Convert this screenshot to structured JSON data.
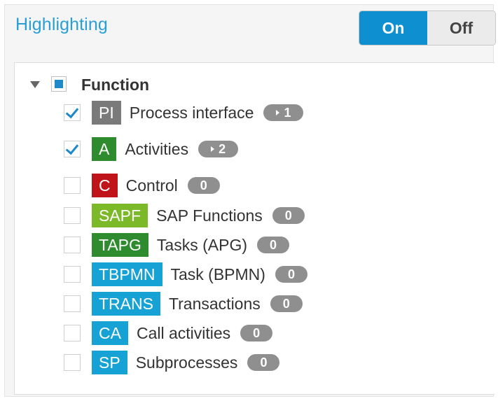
{
  "header": {
    "title": "Highlighting",
    "toggle_on": "On",
    "toggle_off": "Off"
  },
  "colors": {
    "title": "#2a9fd6",
    "toggle_active": "#0e8fd0",
    "check": "#1e88c8",
    "count_pill": "#8f8f8f"
  },
  "tree": {
    "group_label": "Function",
    "items": [
      {
        "badge": "PI",
        "badge_color": "#7a7a7a",
        "label": "Process interface",
        "count": "1",
        "has_arrow": true,
        "checked": true
      },
      {
        "badge": "A",
        "badge_color": "#2e8b2e",
        "label": "Activities",
        "count": "2",
        "has_arrow": true,
        "checked": true
      },
      {
        "badge": "C",
        "badge_color": "#c0141b",
        "label": "Control",
        "count": "0",
        "has_arrow": false,
        "checked": false
      },
      {
        "badge": "SAPF",
        "badge_color": "#7cb928",
        "label": "SAP Functions",
        "count": "0",
        "has_arrow": false,
        "checked": false
      },
      {
        "badge": "TAPG",
        "badge_color": "#2e8b2e",
        "label": "Tasks (APG)",
        "count": "0",
        "has_arrow": false,
        "checked": false
      },
      {
        "badge": "TBPMN",
        "badge_color": "#17a2d6",
        "label": "Task (BPMN)",
        "count": "0",
        "has_arrow": false,
        "checked": false
      },
      {
        "badge": "TRANS",
        "badge_color": "#17a2d6",
        "label": "Transactions",
        "count": "0",
        "has_arrow": false,
        "checked": false
      },
      {
        "badge": "CA",
        "badge_color": "#17a2d6",
        "label": "Call activities",
        "count": "0",
        "has_arrow": false,
        "checked": false
      },
      {
        "badge": "SP",
        "badge_color": "#17a2d6",
        "label": "Subprocesses",
        "count": "0",
        "has_arrow": false,
        "checked": false
      }
    ]
  }
}
